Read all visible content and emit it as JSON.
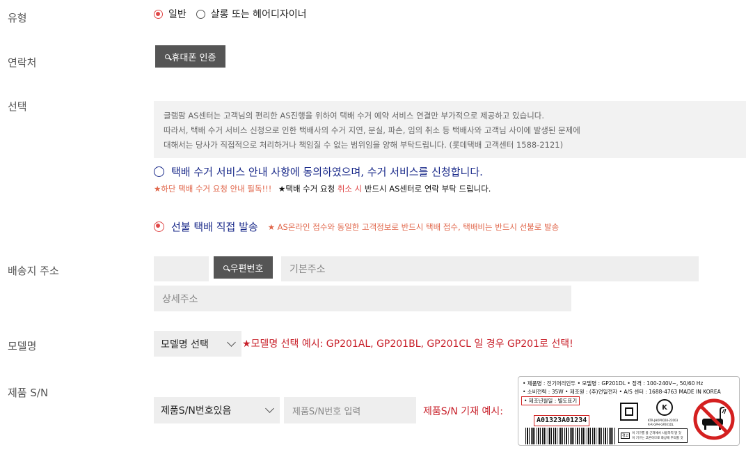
{
  "labels": {
    "type": "유형",
    "contact": "연락처",
    "select": "선택",
    "address": "배송지 주소",
    "model": "모델명",
    "serial": "제품 S/N"
  },
  "type_options": {
    "general": "일반",
    "salon": "살롱 또는 헤어디자이너"
  },
  "contact": {
    "verify_button": "휴대폰 인증"
  },
  "notice": {
    "line1": "글램팜 AS센터는 고객님의 편리한 AS진행을 위하여 택배 수거 예약 서비스 연결만 부가적으로 제공하고 있습니다.",
    "line2": "따라서, 택배 수거 서비스 신청으로 인한 택배사의 수거 지연, 분실, 파손, 임의 취소 등 택배사와 고객님 사이에 발생된 문제에",
    "line3": "대해서는 당사가 직접적으로 처리하거나 책임질 수 없는 범위임을 양해 부탁드립니다. (롯데택배 고객센터 1588-2121)"
  },
  "pickup": {
    "agree_label": "택배 수거 서비스 안내 사항에 동의하였으며, 수거 서비스를 신청합니다.",
    "red_note": "★하단 택배 수거 요청 안내 필독!!!",
    "black_star": "★",
    "note_part1": "택배 수거 요청 ",
    "note_red": "취소 시",
    "note_part2": " 반드시 AS센터로  연락 부탁 드립니다."
  },
  "prepaid": {
    "label": "선불 택배 직접 발송",
    "note": "★ AS온라인 접수와 동일한 고객정보로 반드시 택배 접수, 택배비는 반드시 선불로 발송"
  },
  "address": {
    "zip_button": "우편번호",
    "basic_placeholder": "기본주소",
    "detail_placeholder": "상세주소"
  },
  "model": {
    "select_value": "모델명 선택",
    "hint_star": "★",
    "hint": "모델명 선택 예시: GP201AL, GP201BL, GP201CL 일 경우 GP201로 선택!"
  },
  "serial": {
    "select_value": "제품S/N번호있음",
    "input_placeholder": "제품S/N번호 입력",
    "example_label": "제품S/N 기재 예시:"
  },
  "label_sample": {
    "line1": "• 제품명 : 전기머리인두  • 모델명 : GP201DL  • 정격 : 100-240V~, 50/60 Hz",
    "line2": "• 소비전력 : 35W  • 제조원 : (주)언일전자  • A/S 센터 : 1688-4763  MADE IN KOREA",
    "mfg_date": "• 제조년월일 : 별도표기",
    "serial_no": "A01323A01234",
    "kc_code": "KTR-JHOP0028-22003",
    "kc_sub": "R-R-GPH-GP201DL",
    "warn_tag": "경고",
    "warn1": "이 기구를 물 근처에서 사용하지 말 것",
    "warn2": "이 기구는 고온이므로 화상에 주의할 것"
  },
  "colors": {
    "accent_red": "#e04848",
    "dark_red": "#c8202a",
    "navy": "#1a2a8a",
    "orange_note": "#e0664a"
  }
}
